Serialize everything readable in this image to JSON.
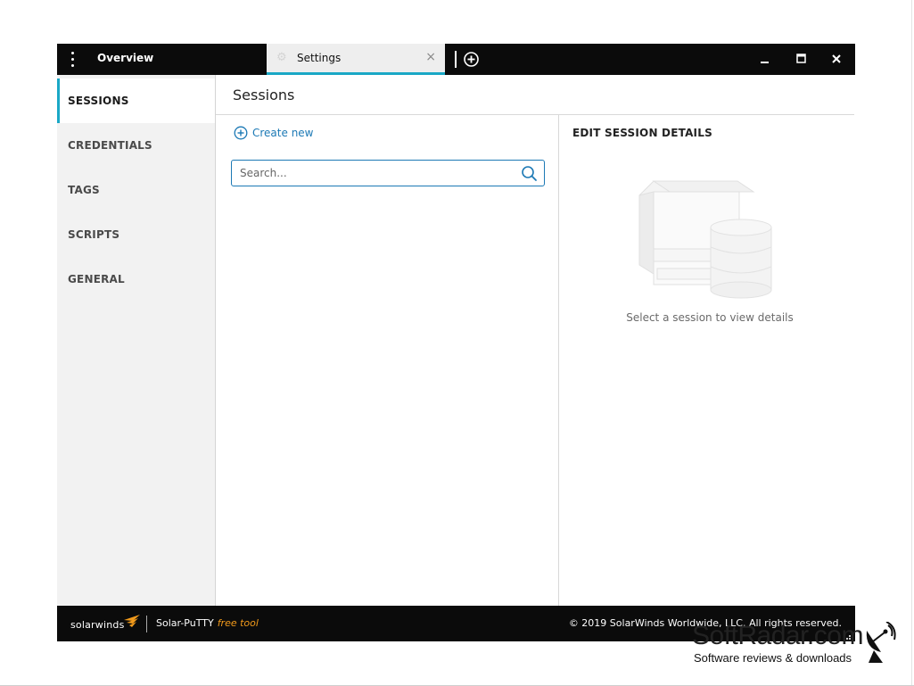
{
  "titlebar": {
    "tabs": [
      {
        "label": "Overview",
        "active": false
      },
      {
        "label": "Settings",
        "active": true,
        "icon": "gear-icon",
        "close_glyph": "×"
      }
    ],
    "add_tab_icon": "plus-circle-icon",
    "window_controls": [
      "minimize-icon",
      "maximize-icon",
      "close-icon"
    ]
  },
  "sidebar": {
    "items": [
      {
        "label": "SESSIONS",
        "active": true
      },
      {
        "label": "CREDENTIALS",
        "active": false
      },
      {
        "label": "TAGS",
        "active": false
      },
      {
        "label": "SCRIPTS",
        "active": false
      },
      {
        "label": "GENERAL",
        "active": false
      }
    ]
  },
  "main": {
    "title": "Sessions",
    "create_new_label": "Create new",
    "search": {
      "placeholder": "Search...",
      "value": ""
    },
    "details": {
      "title": "EDIT SESSION DETAILS",
      "empty_message": "Select a session to view details"
    }
  },
  "footer": {
    "brand": "solarwinds",
    "product": "Solar-PuTTY",
    "product_tag": "free tool",
    "copyright": "© 2019 SolarWinds Worldwide, LLC. All rights reserved."
  },
  "watermark": {
    "site": "SoftRadar.com",
    "tagline": "Software reviews & downloads"
  },
  "colors": {
    "titlebar_bg": "#0b0b0b",
    "accent": "#1aa8c6",
    "link": "#1c79b5",
    "sidebar_bg": "#f2f2f2",
    "brand_orange": "#f19a1b"
  }
}
